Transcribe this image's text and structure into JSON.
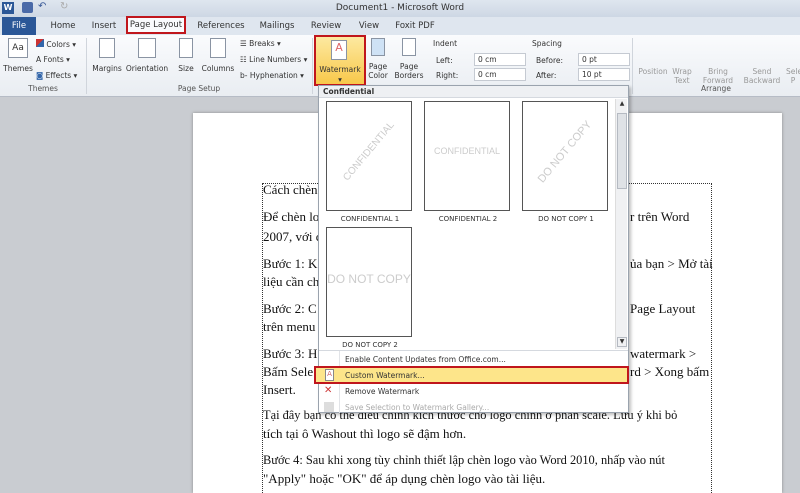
{
  "window": {
    "title": "Document1  -  Microsoft Word",
    "app_icon": "W"
  },
  "tabs": [
    "File",
    "Home",
    "Insert",
    "Page Layout",
    "References",
    "Mailings",
    "Review",
    "View",
    "Foxit PDF"
  ],
  "active_tab": "Page Layout",
  "ribbon": {
    "themes": {
      "themes": "Themes",
      "colors": "Colors",
      "fonts": "Fonts",
      "effects": "Effects",
      "group": "Themes"
    },
    "page_setup": {
      "margins": "Margins",
      "orientation": "Orientation",
      "size": "Size",
      "columns": "Columns",
      "breaks": "Breaks",
      "line_numbers": "Line Numbers",
      "hyphenation": "Hyphenation",
      "group": "Page Setup"
    },
    "page_background": {
      "watermark": "Watermark",
      "page_color": "Page Color",
      "page_color_1": "Page",
      "page_color_2": "Color",
      "page_borders_1": "Page",
      "page_borders_2": "Borders"
    },
    "indent": {
      "title": "Indent",
      "left_label": "Left:",
      "left_value": "0 cm",
      "right_label": "Right:",
      "right_value": "0 cm"
    },
    "spacing": {
      "title": "Spacing",
      "before_label": "Before:",
      "before_value": "0 pt",
      "after_label": "After:",
      "after_value": "10 pt"
    },
    "arrange": {
      "position": "Position",
      "wrap_1": "Wrap",
      "wrap_2": "Text",
      "bring_1": "Bring",
      "bring_2": "Forward",
      "send_1": "Send",
      "send_2": "Backward",
      "select_1": "Sele",
      "select_2": "P",
      "group": "Arrange"
    }
  },
  "watermark_menu": {
    "section": "Confidential",
    "items": [
      {
        "label": "CONFIDENTIAL 1",
        "text": "CONFIDENTIAL"
      },
      {
        "label": "CONFIDENTIAL 2",
        "text": "CONFIDENTIAL"
      },
      {
        "label": "DO NOT COPY 1",
        "text": "DO NOT COPY"
      },
      {
        "label": "DO NOT COPY 2",
        "text": "DO NOT COPY"
      }
    ],
    "actions": {
      "enable": "Enable Content Updates from Office.com...",
      "custom": "Custom Watermark...",
      "remove": "Remove Watermark",
      "save": "Save Selection to Watermark Gallery..."
    }
  },
  "document": {
    "l1": "Cách chèn",
    "l2a": "Để chèn lo",
    "l2b": "r trên Word",
    "l3": "2007, với c",
    "l4a": "Bước 1: K",
    "l4b": "ủa bạn > Mở tài",
    "l5": "liệu cần ch",
    "l6a": "Bước 2: C",
    "l6b": "Page Layout",
    "l7": "trên menu",
    "l8a": "Bước 3: H",
    "l8b": "watermark >",
    "l9a": "Bấm Sele",
    "l9b": "rd > Xong bấm",
    "l10": "Insert.",
    "l11": "Tại đây bạn có thể điều chỉnh kích thước cho logo chỉnh ở phần scale. Lưu ý khi bỏ",
    "l12": "tích tại ô Washout thì logo sẽ đậm hơn.",
    "l13": "Bước 4: Sau khi xong tùy chỉnh thiết lập chèn logo vào Word 2010, nhấp vào nút",
    "l14": "\"Apply\" hoặc \"OK\" để áp dụng chèn logo vào tài liệu."
  },
  "colors": {
    "highlight": "#c0161c",
    "file_tab": "#2b5797",
    "hover": "#fde58a"
  }
}
